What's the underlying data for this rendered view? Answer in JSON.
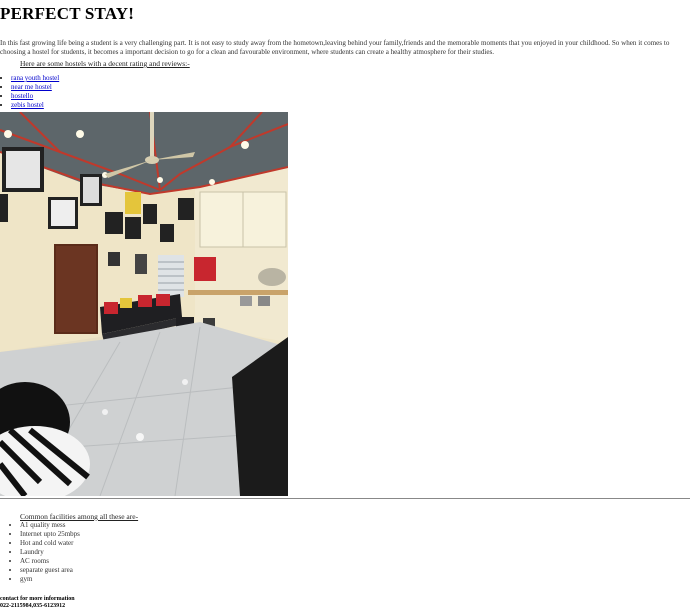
{
  "page": {
    "title": "PERFECT STAY!",
    "intro": "In this fast growing life being a student is a very challenging part. It is not easy to study away from the hometown,leaving behind your family,friends and the memorable moments that you enjoyed in your childhood. So when it comes to choosing a hostel for students, it becomes a important decision to go for a clean and favourable environment, where students can create a healthy atmosphere for their studies.",
    "subhead": "Here are some hostels with a decent rating and reviews:-"
  },
  "hostels": [
    {
      "label": "rana youth hostel"
    },
    {
      "label": "near me hostel"
    },
    {
      "label": "hostello"
    },
    {
      "label": "zebis hostel"
    }
  ],
  "facilities": {
    "heading": "Common facilities among all these are-",
    "items": [
      "A1 quality mess",
      "Internet upto 25mbps",
      "Hot and cold water",
      "Laundry",
      "AC rooms",
      "separate guest area",
      "gym"
    ]
  },
  "contact": {
    "title": "contact for more information",
    "numbers": "022-2115984,035-6123912"
  },
  "colors": {
    "link": "#0000cc",
    "ceiling": "#5d666a",
    "ceiling_beam": "#c0392b",
    "wall": "#efe5c7",
    "floor": "#cfd1d2",
    "door": "#5a2b19",
    "sofa": "#1f1f22",
    "cushion_red": "#c8262f",
    "cushion_yellow": "#e4c53b"
  }
}
